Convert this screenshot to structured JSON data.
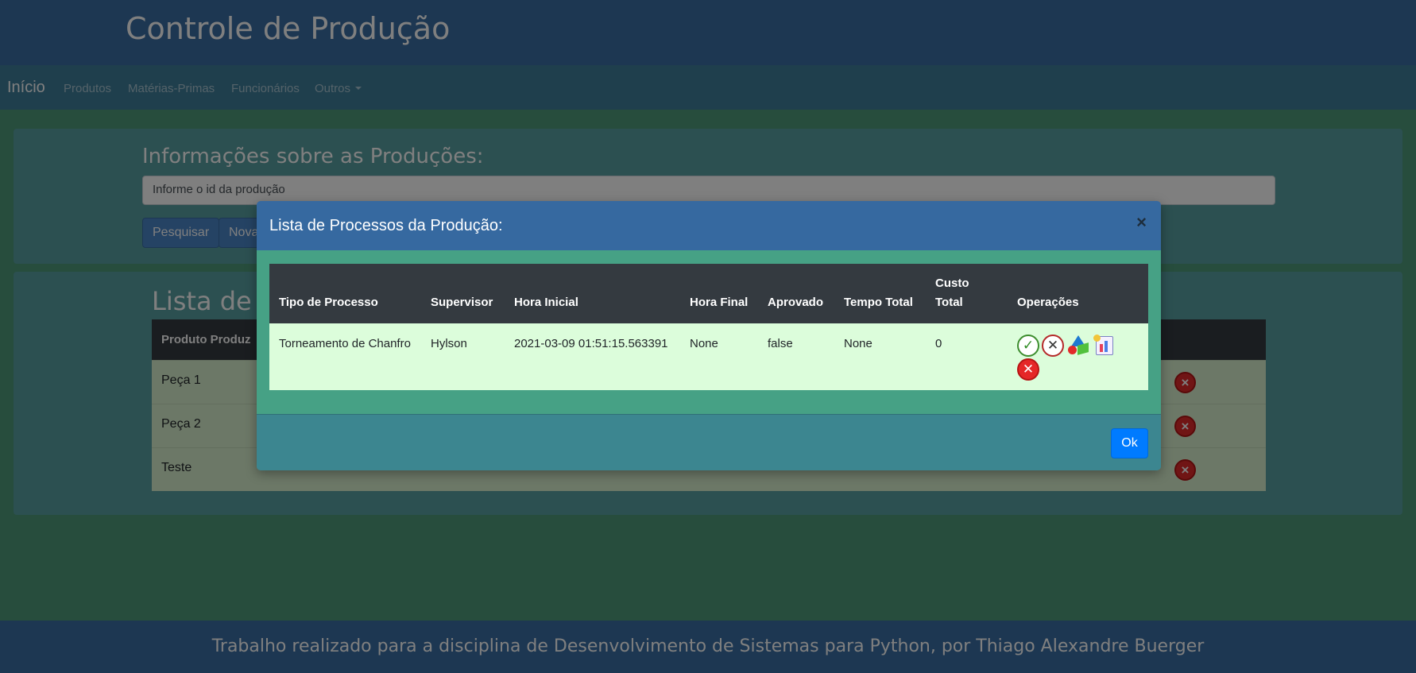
{
  "app": {
    "title": "Controle de Produção"
  },
  "navbar": {
    "brand": "Início",
    "links": [
      "Produtos",
      "Matérias-Primas",
      "Funcionários",
      "Outros"
    ]
  },
  "search_panel": {
    "heading": "Informações sobre as Produções:",
    "placeholder": "Informe o id da produção",
    "search_button": "Pesquisar",
    "new_button": "Nova"
  },
  "list_panel": {
    "heading": "Lista de P",
    "header_first_col": "Produto Produz",
    "rows": [
      "Peça 1",
      "Peça 2",
      "Teste"
    ]
  },
  "modal": {
    "title": "Lista de Processos da Produção:",
    "close_symbol": "×",
    "columns": {
      "tipo": "Tipo de Processo",
      "supervisor": "Supervisor",
      "hora_inicial": "Hora Inicial",
      "hora_final": "Hora Final",
      "aprovado": "Aprovado",
      "tempo_total": "Tempo Total",
      "custo_total": "Custo Total",
      "operacoes": "Operações"
    },
    "rows": [
      {
        "tipo": "Torneamento de Chanfro",
        "supervisor": "Hylson",
        "hora_inicial": "2021-03-09 01:51:15.563391",
        "hora_final": "None",
        "aprovado": "false",
        "tempo_total": "None",
        "custo_total": "0",
        "operacoes": [
          "approve-icon",
          "reject-icon",
          "shapes-icon",
          "report-icon",
          "delete-icon"
        ]
      }
    ],
    "ok_button": "Ok"
  },
  "footer": {
    "text": "Trabalho realizado para a disciplina de Desenvolvimento de Sistemas para Python, por Thiago Alexandre Buerger"
  },
  "colors": {
    "header": "#3a6fa4",
    "modal_header": "#3669a0",
    "table_header": "#343a40",
    "table_row": "#dcfddb",
    "primary_button": "#007bff",
    "delete_red": "#e52727"
  }
}
